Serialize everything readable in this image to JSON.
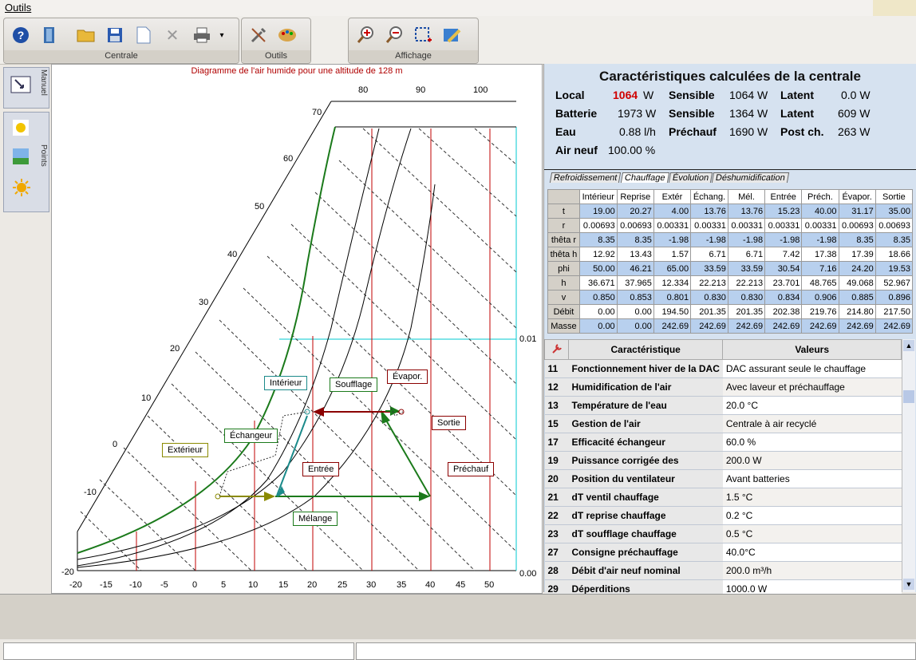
{
  "menu": {
    "outils": "Outils"
  },
  "toolbar": {
    "groups": [
      {
        "label": "Centrale"
      },
      {
        "label": "Outils"
      },
      {
        "label": "Affichage"
      }
    ]
  },
  "left_tabs": {
    "manuel": "Manuel",
    "points": "Points"
  },
  "chart": {
    "title": "Diagramme de l'air humide pour une altitude de 128 m",
    "x_ticks": [
      "-20",
      "-15",
      "-10",
      "-5",
      "0",
      "5",
      "10",
      "15",
      "20",
      "25",
      "30",
      "35",
      "40",
      "45",
      "50"
    ],
    "rh_ticks": [
      "80",
      "90",
      "100"
    ],
    "h_ticks": [
      "70",
      "60",
      "50",
      "40",
      "30",
      "20",
      "10",
      "0",
      "-10",
      "-20"
    ],
    "r_ticks": [
      "0.01",
      "0.00"
    ],
    "labels": {
      "interieur": "Intérieur",
      "soufflage": "Soufflage",
      "evapor": "Évapor.",
      "sortie": "Sortie",
      "echangeur": "Échangeur",
      "exterieur": "Extérieur",
      "entree": "Entrée",
      "prechauf": "Préchauf",
      "melange": "Mélange"
    }
  },
  "calc": {
    "title": "Caractéristiques calculées de la centrale",
    "local_label": "Local",
    "local_val": "1064",
    "local_unit": "W",
    "sensible1_label": "Sensible",
    "sensible1_val": "1064 W",
    "latent1_label": "Latent",
    "latent1_val": "0.0 W",
    "batterie_label": "Batterie",
    "batterie_val": "1973 W",
    "sensible2_label": "Sensible",
    "sensible2_val": "1364 W",
    "latent2_label": "Latent",
    "latent2_val": "609 W",
    "eau_label": "Eau",
    "eau_val": "0.88 l/h",
    "prechauf_label": "Préchauf",
    "prechauf_val": "1690 W",
    "postch_label": "Post ch.",
    "postch_val": "263 W",
    "airneuf_label": "Air neuf",
    "airneuf_val": "100.00 %"
  },
  "tabs": [
    "Refroidissement",
    "Chauffage",
    "Évolution",
    "Déshumidification"
  ],
  "table": {
    "columns": [
      "Intérieur",
      "Reprise",
      "Extér",
      "Échang.",
      "Mél.",
      "Entrée",
      "Préch.",
      "Évapor.",
      "Sortie"
    ],
    "rows": [
      {
        "label": "t",
        "values": [
          "19.00",
          "20.27",
          "4.00",
          "13.76",
          "13.76",
          "15.23",
          "40.00",
          "31.17",
          "35.00"
        ]
      },
      {
        "label": "r",
        "values": [
          "0.00693",
          "0.00693",
          "0.00331",
          "0.00331",
          "0.00331",
          "0.00331",
          "0.00331",
          "0.00693",
          "0.00693"
        ]
      },
      {
        "label": "thêta r",
        "values": [
          "8.35",
          "8.35",
          "-1.98",
          "-1.98",
          "-1.98",
          "-1.98",
          "-1.98",
          "8.35",
          "8.35"
        ]
      },
      {
        "label": "thêta h",
        "values": [
          "12.92",
          "13.43",
          "1.57",
          "6.71",
          "6.71",
          "7.42",
          "17.38",
          "17.39",
          "18.66"
        ]
      },
      {
        "label": "phi",
        "values": [
          "50.00",
          "46.21",
          "65.00",
          "33.59",
          "33.59",
          "30.54",
          "7.16",
          "24.20",
          "19.53"
        ]
      },
      {
        "label": "h",
        "values": [
          "36.671",
          "37.965",
          "12.334",
          "22.213",
          "22.213",
          "23.701",
          "48.765",
          "49.068",
          "52.967"
        ]
      },
      {
        "label": "v",
        "values": [
          "0.850",
          "0.853",
          "0.801",
          "0.830",
          "0.830",
          "0.834",
          "0.906",
          "0.885",
          "0.896"
        ]
      },
      {
        "label": "Débit",
        "values": [
          "0.00",
          "0.00",
          "194.50",
          "201.35",
          "201.35",
          "202.38",
          "219.76",
          "214.80",
          "217.50"
        ]
      },
      {
        "label": "Masse",
        "values": [
          "0.00",
          "0.00",
          "242.69",
          "242.69",
          "242.69",
          "242.69",
          "242.69",
          "242.69",
          "242.69"
        ]
      }
    ]
  },
  "props": {
    "header_name": "Caractéristique",
    "header_value": "Valeurs",
    "rows": [
      {
        "num": "11",
        "name": "Fonctionnement hiver de la DAC",
        "value": "DAC assurant seule le chauffage"
      },
      {
        "num": "12",
        "name": "Humidification de l'air",
        "value": "Avec laveur et préchauffage"
      },
      {
        "num": "13",
        "name": "Température de l'eau",
        "value": "20.0 °C"
      },
      {
        "num": "15",
        "name": "Gestion de l'air",
        "value": "Centrale à air recyclé"
      },
      {
        "num": "17",
        "name": "Efficacité échangeur",
        "value": "60.0 %"
      },
      {
        "num": "19",
        "name": "Puissance corrigée des",
        "value": "200.0 W"
      },
      {
        "num": "20",
        "name": "Position du ventilateur",
        "value": "Avant batteries"
      },
      {
        "num": "21",
        "name": "dT ventil chauffage",
        "value": "1.5 °C"
      },
      {
        "num": "22",
        "name": "dT reprise chauffage",
        "value": "0.2 °C"
      },
      {
        "num": "23",
        "name": "dT soufflage chauffage",
        "value": "0.5 °C"
      },
      {
        "num": "27",
        "name": "Consigne préchauffage",
        "value": "40.0°C"
      },
      {
        "num": "28",
        "name": "Débit d'air neuf nominal",
        "value": "200.0 m³/h"
      },
      {
        "num": "29",
        "name": "Déperditions",
        "value": "1000.0 W"
      }
    ]
  }
}
